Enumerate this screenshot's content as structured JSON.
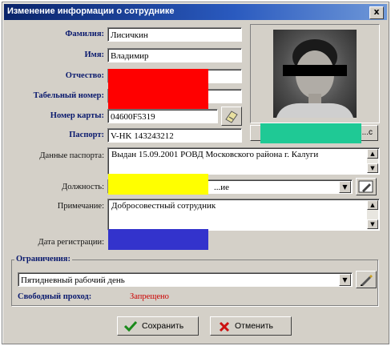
{
  "window": {
    "title": "Изменение информации о сотруднике",
    "close_label": "x"
  },
  "form": {
    "surname_label": "Фамилия:",
    "surname_value": "Лисичкин",
    "name_label": "Имя:",
    "name_value": "Владимир",
    "patronymic_label": "Отчество:",
    "tabnum_label": "Табельный номер:",
    "card_label": "Номер карты:",
    "card_value": "04600F5319",
    "passport_label": "Паспорт:",
    "passport_value": "V-HK 143243212",
    "passport_data_label": "Данные паспорта:",
    "passport_data_value": "Выдан 15.09.2001 РОВД Московского района г. Калуги",
    "position_label": "Должность:",
    "position_value": "...ие",
    "notes_label": "Примечание:",
    "notes_value": "Добросовестный сотрудник",
    "regdate_label": "Дата регистрации:"
  },
  "photo": {
    "button_label": "...с"
  },
  "restrictions": {
    "group_label": "Ограничения:",
    "schedule_value": "Пятидневный рабочий день",
    "pass_label": "Свободный проход:",
    "pass_value": "Запрещено"
  },
  "buttons": {
    "save_label": "Сохранить",
    "cancel_label": "Отменить"
  },
  "colors": {
    "redact_red": "#ff0000",
    "redact_yellow": "#ffff00",
    "redact_blue": "#3333cc",
    "redact_teal": "#1fc995",
    "denied": "#cc0000"
  }
}
